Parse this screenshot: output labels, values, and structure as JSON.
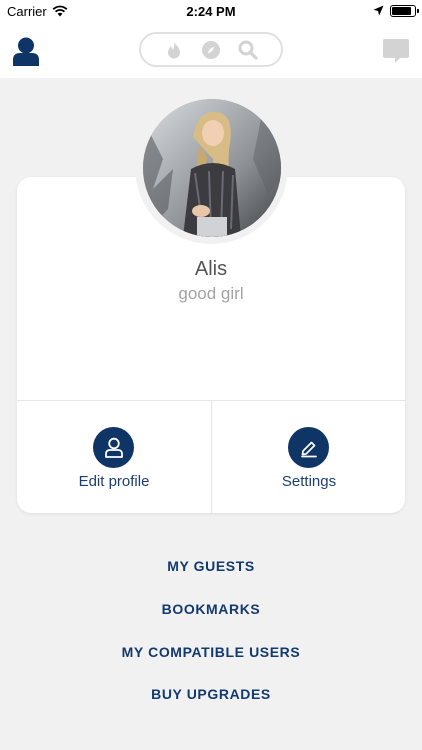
{
  "status_bar": {
    "carrier": "Carrier",
    "time": "2:24 PM",
    "battery_level": 0.9
  },
  "nav": {
    "profile_icon": "profile-icon",
    "segments": [
      "flame-icon",
      "compass-icon",
      "search-icon"
    ],
    "chat_icon": "chat-icon"
  },
  "profile": {
    "name": "Alis",
    "status": "good girl"
  },
  "actions": {
    "edit_profile": "Edit profile",
    "settings": "Settings"
  },
  "menu": {
    "guests": "MY GUESTS",
    "bookmarks": "BOOKMARKS",
    "compatible": "MY COMPATIBLE USERS",
    "upgrades": "BUY UPGRADES"
  },
  "colors": {
    "accent": "#0f3567",
    "link": "#133a6e",
    "background": "#f1f1f1"
  }
}
